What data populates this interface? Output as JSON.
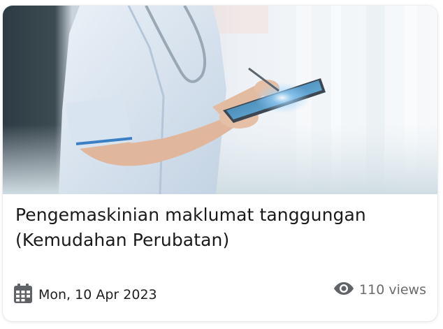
{
  "article": {
    "title": "Pengemaskinian maklumat tanggungan (Kemudahan Perubatan)",
    "date": "Mon, 10 Apr 2023",
    "views": "110 views"
  },
  "icons": {
    "date": "calendar-icon",
    "views": "eye-icon"
  },
  "colors": {
    "title": "#1a1a1a",
    "date_text": "#1f1f1f",
    "muted": "#6b6b6b",
    "icon": "#5f6368"
  }
}
